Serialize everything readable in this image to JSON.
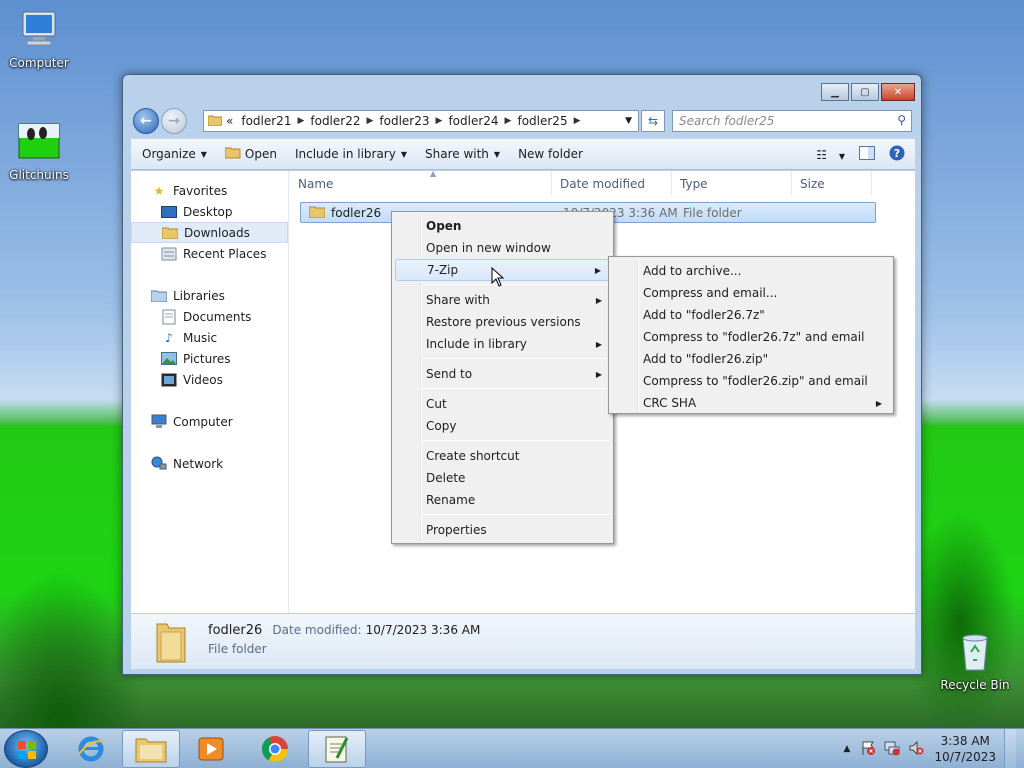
{
  "desktop": {
    "icons": [
      {
        "label": "Computer"
      },
      {
        "label": "Glitchuins"
      },
      {
        "label": "Recycle Bin"
      }
    ]
  },
  "window": {
    "breadcrumb_prefix": "«",
    "breadcrumb": [
      "fodler21",
      "fodler22",
      "fodler23",
      "fodler24",
      "fodler25"
    ],
    "search_placeholder": "Search fodler25",
    "toolbar": {
      "organize": "Organize",
      "open": "Open",
      "include_in_library": "Include in library",
      "share_with": "Share with",
      "new_folder": "New folder"
    },
    "nav": {
      "favorites": "Favorites",
      "desktop": "Desktop",
      "downloads": "Downloads",
      "recent_places": "Recent Places",
      "libraries": "Libraries",
      "documents": "Documents",
      "music": "Music",
      "pictures": "Pictures",
      "videos": "Videos",
      "computer": "Computer",
      "network": "Network"
    },
    "columns": {
      "name": "Name",
      "date_modified": "Date modified",
      "type": "Type",
      "size": "Size"
    },
    "files": [
      {
        "name": "fodler26",
        "date": "10/7/2023 3:36 AM",
        "type": "File folder"
      }
    ],
    "details": {
      "name": "fodler26",
      "date_label": "Date modified:",
      "date_value": "10/7/2023 3:36 AM",
      "type": "File folder"
    }
  },
  "context_menu": {
    "open": "Open",
    "open_new_window": "Open in new window",
    "seven_zip": "7-Zip",
    "share_with": "Share with",
    "restore": "Restore previous versions",
    "include_in_library": "Include in library",
    "send_to": "Send to",
    "cut": "Cut",
    "copy": "Copy",
    "create_shortcut": "Create shortcut",
    "delete": "Delete",
    "rename": "Rename",
    "properties": "Properties"
  },
  "zip_submenu": {
    "add_archive": "Add to archive...",
    "compress_email": "Compress and email...",
    "add_7z": "Add to \"fodler26.7z\"",
    "compress_7z_email": "Compress to \"fodler26.7z\" and email",
    "add_zip": "Add to \"fodler26.zip\"",
    "compress_zip_email": "Compress to \"fodler26.zip\" and email",
    "crc_sha": "CRC SHA"
  },
  "taskbar": {
    "time": "3:38 AM",
    "date": "10/7/2023"
  },
  "colors": {
    "selection": "#c1dcfb",
    "menu_bg": "#f0f0f0",
    "window_frame": "#b9d1ea"
  }
}
